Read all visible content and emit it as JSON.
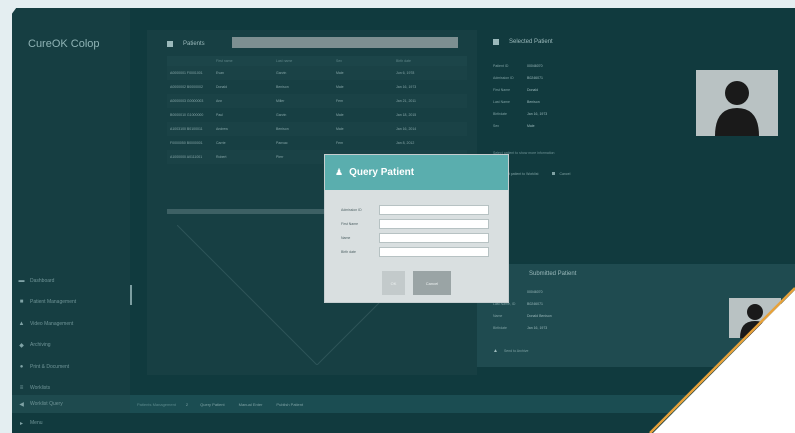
{
  "app": {
    "title": "CureOK Colop"
  },
  "sidebar": {
    "items": [
      {
        "label": "Dashboard",
        "icon": "dashboard-icon",
        "glyph": "▬"
      },
      {
        "label": "Patient Management",
        "icon": "users-icon",
        "glyph": "■"
      },
      {
        "label": "Video Management",
        "icon": "video-icon",
        "glyph": "▲"
      },
      {
        "label": "Archiving",
        "icon": "archive-icon",
        "glyph": "◆"
      },
      {
        "label": "Print & Document",
        "icon": "print-icon",
        "glyph": "●"
      },
      {
        "label": "Worklists",
        "icon": "list-icon",
        "glyph": "≡"
      },
      {
        "label": "Worklist Query",
        "icon": "query-icon",
        "glyph": "◀",
        "active": true
      },
      {
        "label": "Menu",
        "icon": "menu-icon",
        "glyph": "▸"
      }
    ]
  },
  "patients_panel": {
    "title": "Patients",
    "search_value": "",
    "columns": [
      "",
      "First name",
      "Last name",
      "Sex",
      "Birth date"
    ],
    "rows": [
      [
        "A0000001 F0001001",
        "Evan",
        "Garvin",
        "Male",
        "Jun 6, 1978"
      ],
      [
        "A0000002 B0000002",
        "Donald",
        "Benison",
        "Male",
        "Jan 16, 1973"
      ],
      [
        "A0000003 G0000003",
        "Ann",
        "Miller",
        "Fem",
        "Jan 21, 2011"
      ],
      [
        "B0000010 G1000000",
        "Paul",
        "Garvin",
        "Male",
        "Jan 18, 2015"
      ],
      [
        "A1003100 B0100011",
        "Andrew",
        "Benison",
        "Male",
        "Jan 16, 2014"
      ],
      [
        "F0000050 B0000001",
        "Carrie",
        "Panvac",
        "Fem",
        "Jan 8, 2012"
      ],
      [
        "A1000000 A0111001",
        "Robert",
        "Pierr",
        "Male",
        "Jan 16, 2011"
      ]
    ]
  },
  "selected_patient": {
    "title": "Selected Patient",
    "fields": [
      {
        "label": "Patient ID",
        "value": "00046070"
      },
      {
        "label": "Admission ID",
        "value": "B0246071"
      },
      {
        "label": "First Name",
        "value": "Donald"
      },
      {
        "label": "Last Name",
        "value": "Benison"
      },
      {
        "label": "Birthdate",
        "value": "Jan 16, 1973"
      },
      {
        "label": "Sex",
        "value": "Male"
      }
    ],
    "note": "Select patient to show more information",
    "actions": [
      "Select patient to Worklist",
      "Cancel"
    ]
  },
  "submitted_patient": {
    "title": "Submitted Patient",
    "fields": [
      {
        "label": "Patient ID",
        "value": "00046070"
      },
      {
        "label": "Last Name, ID",
        "value": "B0246071"
      },
      {
        "label": "Name",
        "value": "Donald Benison"
      },
      {
        "label": "Birthdate",
        "value": "Jan 16, 1973"
      }
    ],
    "action": "Send to Archive"
  },
  "status_bar": {
    "section": "Patients Management",
    "number": "2",
    "items": [
      "Query Patient",
      "Manual Enter",
      "Publish Patient"
    ]
  },
  "modal": {
    "title": "Query Patient",
    "fields": [
      {
        "label": "Admission ID",
        "value": ""
      },
      {
        "label": "First Name",
        "value": ""
      },
      {
        "label": "Name",
        "value": ""
      },
      {
        "label": "Birth date",
        "value": ""
      }
    ],
    "ok_label": "OK",
    "cancel_label": "Cancel"
  },
  "colors": {
    "background": "#103a3e",
    "modal_header": "#5aaeae",
    "accent_orange": "#e8a23a"
  }
}
